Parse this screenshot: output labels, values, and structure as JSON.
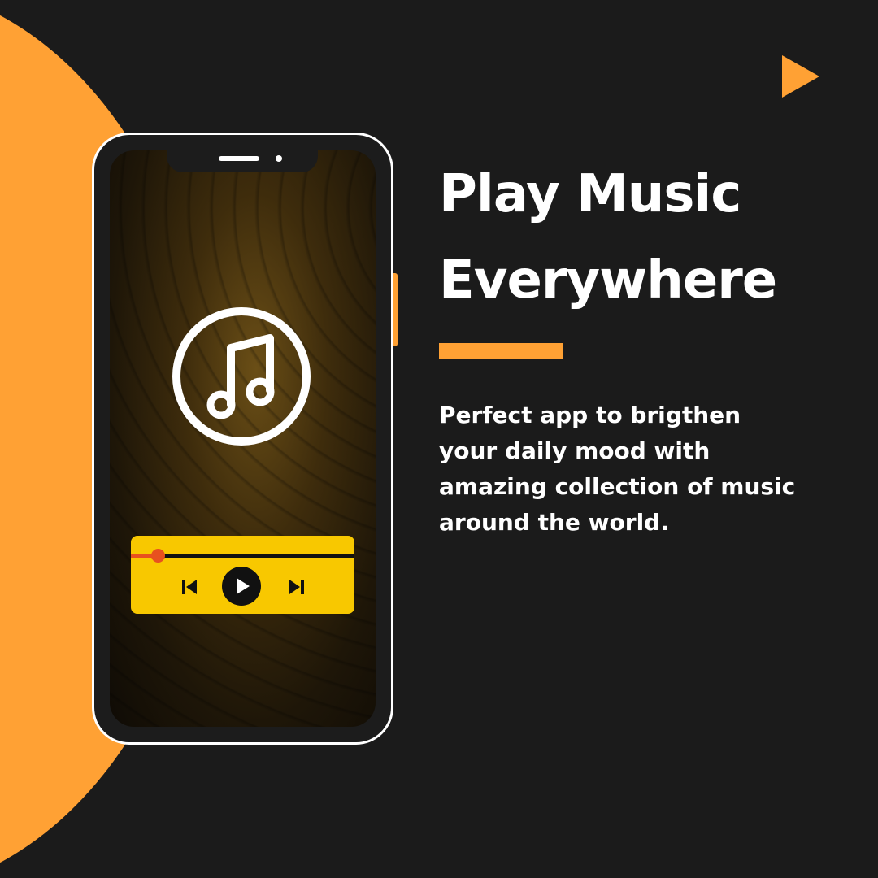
{
  "colors": {
    "background": "#1b1b1b",
    "accent": "#ffa134",
    "player": "#f8c800",
    "progress": "#e8511f",
    "text": "#ffffff"
  },
  "icons": {
    "top_right": "play-triangle-icon",
    "screen": "music-note-icon",
    "prev": "skip-previous-icon",
    "play": "play-icon",
    "next": "skip-next-icon"
  },
  "headline": {
    "line1": "Play Music",
    "line2": "Everywhere"
  },
  "body": {
    "line1": "Perfect app to brigthen",
    "line2": "your daily mood with",
    "line3": "amazing collection of music",
    "line4": "around the world."
  },
  "player": {
    "progress": 0.12
  }
}
